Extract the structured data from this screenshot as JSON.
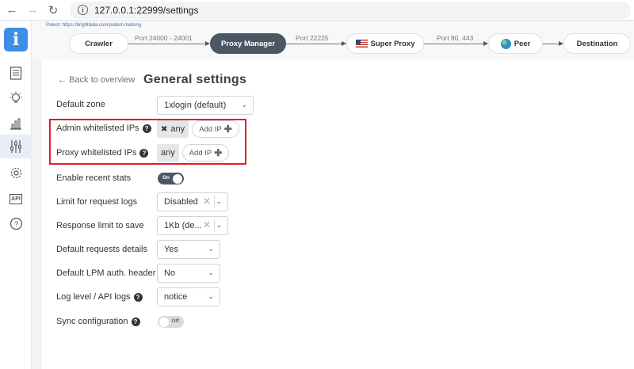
{
  "browser": {
    "url": "127.0.0.1:22999/settings",
    "back_icon": "←",
    "forward_icon": "→",
    "reload_icon": "↻",
    "info_icon": "i"
  },
  "sidebar": {
    "logo": "i",
    "items": [
      {
        "name": "logs",
        "icon": "logs-icon"
      },
      {
        "name": "tips",
        "icon": "lightbulb-icon"
      },
      {
        "name": "stats",
        "icon": "stats-icon"
      },
      {
        "name": "settings",
        "icon": "sliders-icon",
        "active": true
      },
      {
        "name": "config",
        "icon": "gear-icon"
      },
      {
        "name": "api",
        "icon": "api-icon",
        "label": "API"
      },
      {
        "name": "help",
        "icon": "help-icon"
      }
    ]
  },
  "topology": {
    "patent": "Patent: https://brightdata.com/patent-marking",
    "nodes": {
      "crawler": "Crawler",
      "proxy_manager": "Proxy Manager",
      "super_proxy": "Super Proxy",
      "peer": "Peer",
      "destination": "Destination"
    },
    "ports": {
      "crawler_to_pm": "Port 24000 - 24001",
      "pm_to_sp": "Port 22225",
      "sp_to_peer": "Port 80, 443"
    }
  },
  "settings": {
    "back_link": "Back to overview",
    "back_arrow": "←",
    "title": "General settings",
    "default_zone": {
      "label": "Default zone",
      "value": "1xlogin (default)"
    },
    "admin_whitelist": {
      "label": "Admin whitelisted IPs",
      "tag": "any",
      "add_button": "Add IP"
    },
    "proxy_whitelist": {
      "label": "Proxy whitelisted IPs",
      "tag": "any",
      "add_button": "Add IP"
    },
    "recent_stats": {
      "label": "Enable recent stats",
      "state": "On"
    },
    "request_logs_limit": {
      "label": "Limit for request logs",
      "value": "Disabled"
    },
    "response_limit": {
      "label": "Response limit to save",
      "value": "1Kb (de..."
    },
    "request_details": {
      "label": "Default requests details",
      "value": "Yes"
    },
    "lpm_auth_header": {
      "label": "Default LPM auth. header",
      "value": "No"
    },
    "log_level": {
      "label": "Log level / API logs",
      "value": "notice"
    },
    "sync_config": {
      "label": "Sync configuration",
      "state": "Off"
    },
    "help_glyph": "?",
    "remove_glyph": "✖",
    "clear_glyph": "✕",
    "chevron_glyph": "⌄",
    "plus_glyph": "✚"
  },
  "colors": {
    "highlight": "#e01f2a",
    "accent": "#4a5765",
    "logo": "#3d8fe6"
  }
}
